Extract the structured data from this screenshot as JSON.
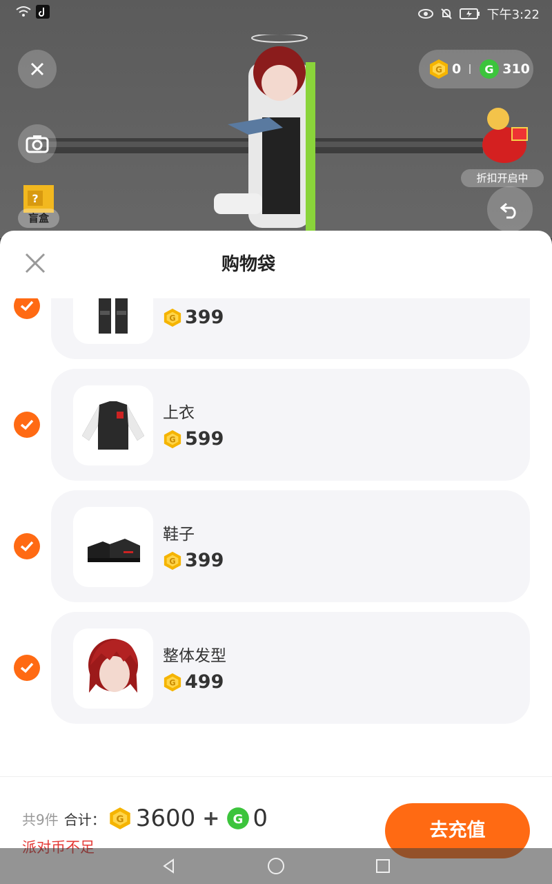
{
  "statusbar": {
    "time": "下午3:22"
  },
  "scene": {
    "balance_gold": "0",
    "balance_green": "310",
    "discount_label": "折扣开启中",
    "blindbox_label": "盲盒"
  },
  "sheet": {
    "title": "购物袋",
    "items": [
      {
        "name": "",
        "price": "399",
        "checked": true,
        "icon": "pants-icon"
      },
      {
        "name": "上衣",
        "price": "599",
        "checked": true,
        "icon": "jacket-icon"
      },
      {
        "name": "鞋子",
        "price": "399",
        "checked": true,
        "icon": "shoes-icon"
      },
      {
        "name": "整体发型",
        "price": "499",
        "checked": true,
        "icon": "hairstyle-icon"
      }
    ]
  },
  "footer": {
    "count": "共9件",
    "total_label": "合计：",
    "gold_total": "3600",
    "plus": "+",
    "green_total": "0",
    "warning": "派对币不足",
    "recharge_label": "去充值"
  },
  "colors": {
    "accent": "#ff6a13",
    "warning": "#e53935",
    "gold_coin": "#f5b400",
    "green_coin": "#3cc43c"
  }
}
